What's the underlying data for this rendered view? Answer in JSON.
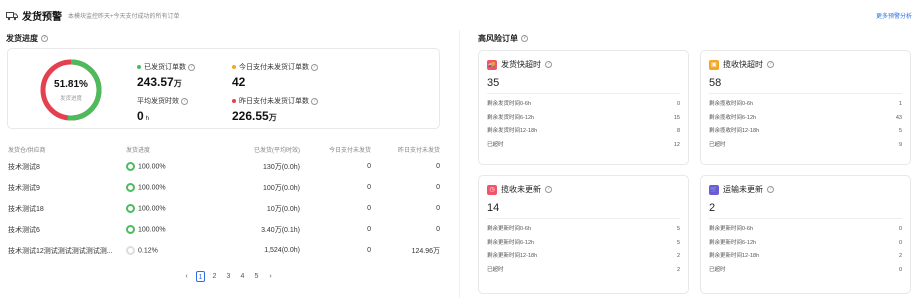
{
  "header": {
    "title": "发货预警",
    "subtitle": "本模块监控昨天+今天支付成功的所有订单",
    "more_link": "更多预警分析"
  },
  "progress": {
    "title": "发货进度",
    "ring_percent": "51.81%",
    "ring_label": "发货进度",
    "ring_fraction": 0.5181,
    "stats": {
      "shipped_label": "已发货订单数",
      "shipped_value": "243.57",
      "shipped_unit": "万",
      "today_unshipped_label": "今日支付未发货订单数",
      "today_unshipped_value": "42",
      "avg_time_label": "平均发货时效",
      "avg_time_value": "0",
      "avg_time_unit": "h",
      "yesterday_unshipped_label": "昨日支付未发货订单数",
      "yesterday_unshipped_value": "226.55",
      "yesterday_unshipped_unit": "万"
    },
    "colors": {
      "green": "#4cbb5c",
      "red": "#e5404f",
      "orange": "#f5a623"
    }
  },
  "table": {
    "headers": [
      "发货仓/供应商",
      "发货进度",
      "已发货(平均时效)",
      "今日支付未发货",
      "昨日支付未发货"
    ],
    "rows": [
      {
        "name": "技术测试8",
        "progress": "100.00%",
        "progress_fraction": 1.0,
        "shipped": "130万(0.0h)",
        "today": "0",
        "yesterday": "0"
      },
      {
        "name": "技术测试9",
        "progress": "100.00%",
        "progress_fraction": 1.0,
        "shipped": "100万(0.0h)",
        "today": "0",
        "yesterday": "0"
      },
      {
        "name": "技术测试18",
        "progress": "100.00%",
        "progress_fraction": 1.0,
        "shipped": "10万(0.0h)",
        "today": "0",
        "yesterday": "0"
      },
      {
        "name": "技术测试6",
        "progress": "100.00%",
        "progress_fraction": 1.0,
        "shipped": "3.40万(0.1h)",
        "today": "0",
        "yesterday": "0"
      },
      {
        "name": "技术测试12测试测试测试测试测...",
        "progress": "0.12%",
        "progress_fraction": 0.0012,
        "shipped": "1,524(0.0h)",
        "today": "0",
        "yesterday": "124.96万"
      }
    ]
  },
  "pagination": {
    "prev": "‹",
    "pages": [
      "1",
      "2",
      "3",
      "4",
      "5"
    ],
    "active": "1",
    "next": "›"
  },
  "risk": {
    "title": "高风险订单",
    "cards": [
      {
        "id": "ship-timeout",
        "title": "发货快超时",
        "icon": "truck-icon",
        "icon_glyph": "🚚",
        "icon_color": "#f0556a",
        "count": "35",
        "rows": [
          {
            "label": "剩余发货时间0-6h",
            "value": "0"
          },
          {
            "label": "剩余发货时间6-12h",
            "value": "15"
          },
          {
            "label": "剩余发货时间12-18h",
            "value": "8"
          },
          {
            "label": "已超时",
            "value": "12"
          }
        ]
      },
      {
        "id": "collect-timeout",
        "title": "揽收快超时",
        "icon": "package-icon",
        "icon_glyph": "▣",
        "icon_color": "#f5a623",
        "count": "58",
        "rows": [
          {
            "label": "剩余揽收时间0-6h",
            "value": "1"
          },
          {
            "label": "剩余揽收时间6-12h",
            "value": "43"
          },
          {
            "label": "剩余揽收时间12-18h",
            "value": "5"
          },
          {
            "label": "已超时",
            "value": "9"
          }
        ]
      },
      {
        "id": "collect-not-updated",
        "title": "揽收未更新",
        "icon": "clock-icon",
        "icon_glyph": "◷",
        "icon_color": "#f0556a",
        "count": "14",
        "rows": [
          {
            "label": "剩余更新时间0-6h",
            "value": "5"
          },
          {
            "label": "剩余更新时间6-12h",
            "value": "5"
          },
          {
            "label": "剩余更新时间12-18h",
            "value": "2"
          },
          {
            "label": "已超时",
            "value": "2"
          }
        ]
      },
      {
        "id": "transport-not-updated",
        "title": "运输未更新",
        "icon": "cart-icon",
        "icon_glyph": "🛒",
        "icon_color": "#6a5ad9",
        "count": "2",
        "rows": [
          {
            "label": "剩余更新时间0-6h",
            "value": "0"
          },
          {
            "label": "剩余更新时间6-12h",
            "value": "0"
          },
          {
            "label": "剩余更新时间12-18h",
            "value": "2"
          },
          {
            "label": "已超时",
            "value": "0"
          }
        ]
      }
    ]
  }
}
